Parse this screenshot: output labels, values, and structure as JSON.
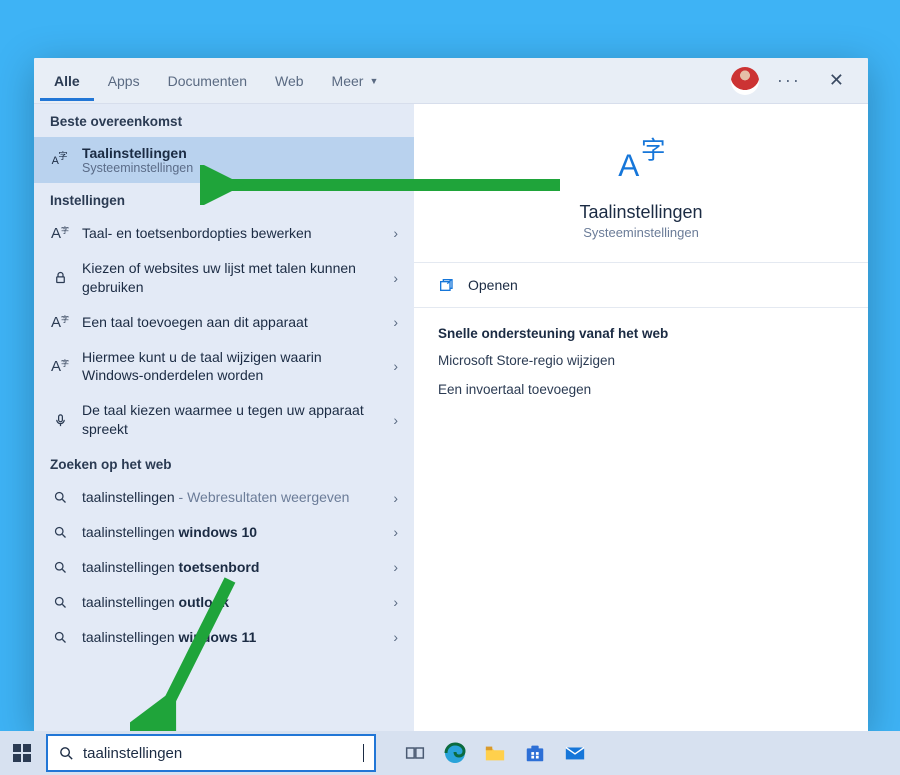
{
  "tabs": {
    "all": "Alle",
    "apps": "Apps",
    "docs": "Documenten",
    "web": "Web",
    "more": "Meer"
  },
  "sections": {
    "bestMatch": "Beste overeenkomst",
    "settings": "Instellingen",
    "webSearch": "Zoeken op het web"
  },
  "bestMatch": {
    "title": "Taalinstellingen",
    "sub": "Systeeminstellingen"
  },
  "settingsItems": [
    "Taal- en toetsenbordopties bewerken",
    "Kiezen of websites uw lijst met talen kunnen gebruiken",
    "Een taal toevoegen aan dit apparaat",
    "Hiermee kunt u de taal wijzigen waarin Windows-onderdelen worden",
    "De taal kiezen waarmee u tegen uw apparaat spreekt"
  ],
  "webItems": [
    {
      "pre": "taalinstellingen",
      "mid": " - ",
      "mid2": "Webresultaten weergeven",
      "bold": ""
    },
    {
      "pre": "taalinstellingen ",
      "bold": "windows 10"
    },
    {
      "pre": "taalinstellingen ",
      "bold": "toetsenbord"
    },
    {
      "pre": "taalinstellingen ",
      "bold": "outlook"
    },
    {
      "pre": "taalinstellingen ",
      "bold": "windows 11"
    }
  ],
  "detail": {
    "title": "Taalinstellingen",
    "sub": "Systeeminstellingen",
    "open": "Openen",
    "supportHead": "Snelle ondersteuning vanaf het web",
    "supportLinks": [
      "Microsoft Store-regio wijzigen",
      "Een invoertaal toevoegen"
    ]
  },
  "search": {
    "value": "taalinstellingen"
  }
}
